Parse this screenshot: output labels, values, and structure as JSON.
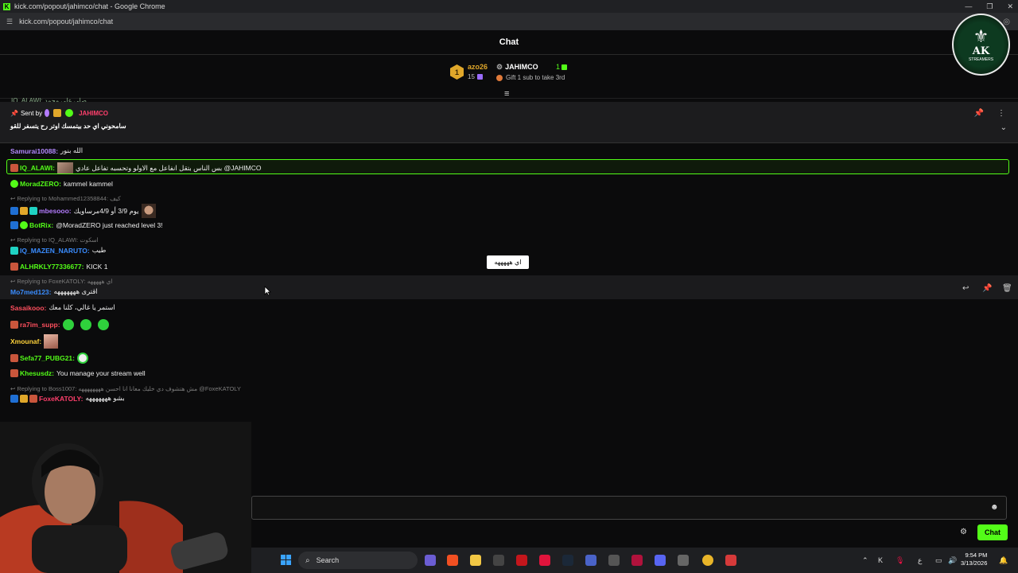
{
  "browser": {
    "window_title": "kick.com/popout/jahimco/chat - Google Chrome",
    "url": "kick.com/popout/jahimco/chat"
  },
  "header": {
    "title": "Chat"
  },
  "leaderboard": {
    "first": {
      "rank": "1",
      "name": "azo26",
      "count": "15"
    },
    "second": {
      "name": "JAHIMCO",
      "count": "1",
      "cta": "Gift 1 sub to take 3rd"
    }
  },
  "pinned": {
    "sent_by": "Sent by",
    "sender": "JAHIMCO",
    "message": "سامحوني اي حد بيتمسك اوتر رح يتسفر للقو"
  },
  "cutoff_line": "IQ_ALAWI: صلي على محمد",
  "messages": [
    {
      "user": "Samurai10088",
      "text": "الله بنور",
      "color": "#b388ff"
    },
    {
      "user": "IQ_ALAWI",
      "text": "بس الناس بتقل انفاعل مع الاولو وتحسبه تفاعل عادي @JAHIMCO",
      "color": "#53fc18"
    },
    {
      "user": "MoradZERO",
      "text": "kammel kammel",
      "color": "#53fc18"
    },
    {
      "reply": "Replying to Mohammed12358844: كيف"
    },
    {
      "user": "mbesooo",
      "text": "يوم 3/9 أو 4/9مرساويك",
      "color": "#b47cff"
    },
    {
      "user": "BotRix",
      "text": "@MoradZERO just reached level 3!",
      "color": "#53fc18"
    },
    {
      "reply": "Replying to IQ_ALAWI: اسكوت"
    },
    {
      "user": "IQ_MAZEN_NARUTO",
      "text": "طيب",
      "color": "#3a8dff"
    },
    {
      "user": "ALHRKLY77336677",
      "text": "KICK 1",
      "color": "#53fc18"
    },
    {
      "reply": "Replying to FoxeKATOLY: اي هههههه"
    },
    {
      "user": "Mo7med123",
      "text": "اقترى هههههههه",
      "color": "#3a8dff"
    },
    {
      "user": "Sasaikooo",
      "text": "استمر يا غالي، كلنا معك",
      "color": "#ff4f5e"
    },
    {
      "user": "ra7im_supp",
      "text": "",
      "color": "#ff4f5e"
    },
    {
      "user": "Xmounaf",
      "text": "",
      "color": "#ffd23a"
    },
    {
      "user": "Sefa77_PUBG21",
      "text": "",
      "color": "#53fc18"
    },
    {
      "user": "Khesusdz",
      "text": "You manage your stream well",
      "color": "#53fc18"
    },
    {
      "reply": "Replying to Boss1007: مش هتشوف دي خليك معانا انا احسن ههههههههه @FoxeKATOLY"
    },
    {
      "user": "FoxeKATOLY",
      "text": "بشو هههههههه",
      "color": "#ff3f6c"
    }
  ],
  "tooltip": "اي هههههه",
  "input": {
    "placeholder": "",
    "send_label": "Chat"
  },
  "logo": {
    "line1": "AK",
    "line2": "STREAMERS"
  },
  "taskbar": {
    "search_label": "Search",
    "time": "9:54 PM",
    "date": "3/13/2026",
    "lang": "ع"
  }
}
